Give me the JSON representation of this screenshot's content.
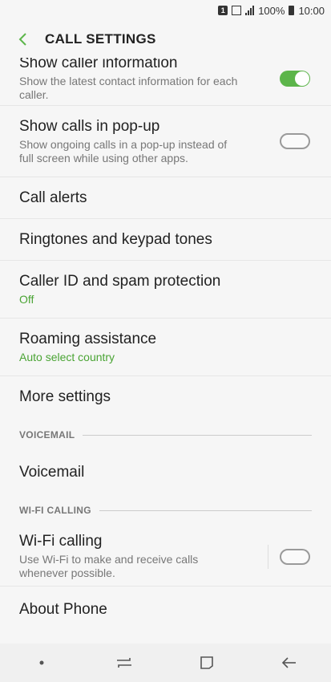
{
  "status_bar": {
    "sim_label": "1",
    "battery_percent": "100%",
    "time": "10:00"
  },
  "app_bar": {
    "title": "CALL SETTINGS"
  },
  "items": {
    "caller_info": {
      "title": "Show caller information",
      "subtitle": "Show the latest contact information for each caller.",
      "toggle": "on"
    },
    "popup": {
      "title": "Show calls in pop-up",
      "subtitle": "Show ongoing calls in a pop-up instead of full screen while using other apps.",
      "toggle": "off"
    },
    "call_alerts": {
      "title": "Call alerts"
    },
    "ringtones": {
      "title": "Ringtones and keypad tones"
    },
    "caller_id": {
      "title": "Caller ID and spam protection",
      "subtitle": "Off"
    },
    "roaming": {
      "title": "Roaming assistance",
      "subtitle": "Auto select country"
    },
    "more_settings": {
      "title": "More settings"
    },
    "voicemail": {
      "title": "Voicemail"
    },
    "wifi_calling": {
      "title": "Wi-Fi calling",
      "subtitle": "Use Wi-Fi to make and receive calls whenever possible.",
      "toggle": "off"
    },
    "about_phone": {
      "title": "About Phone"
    }
  },
  "sections": {
    "voicemail": "VOICEMAIL",
    "wifi_calling": "WI-FI CALLING"
  },
  "colors": {
    "accent": "#5cb54a",
    "accent_text": "#4aa434",
    "background": "#f6f6f6"
  }
}
